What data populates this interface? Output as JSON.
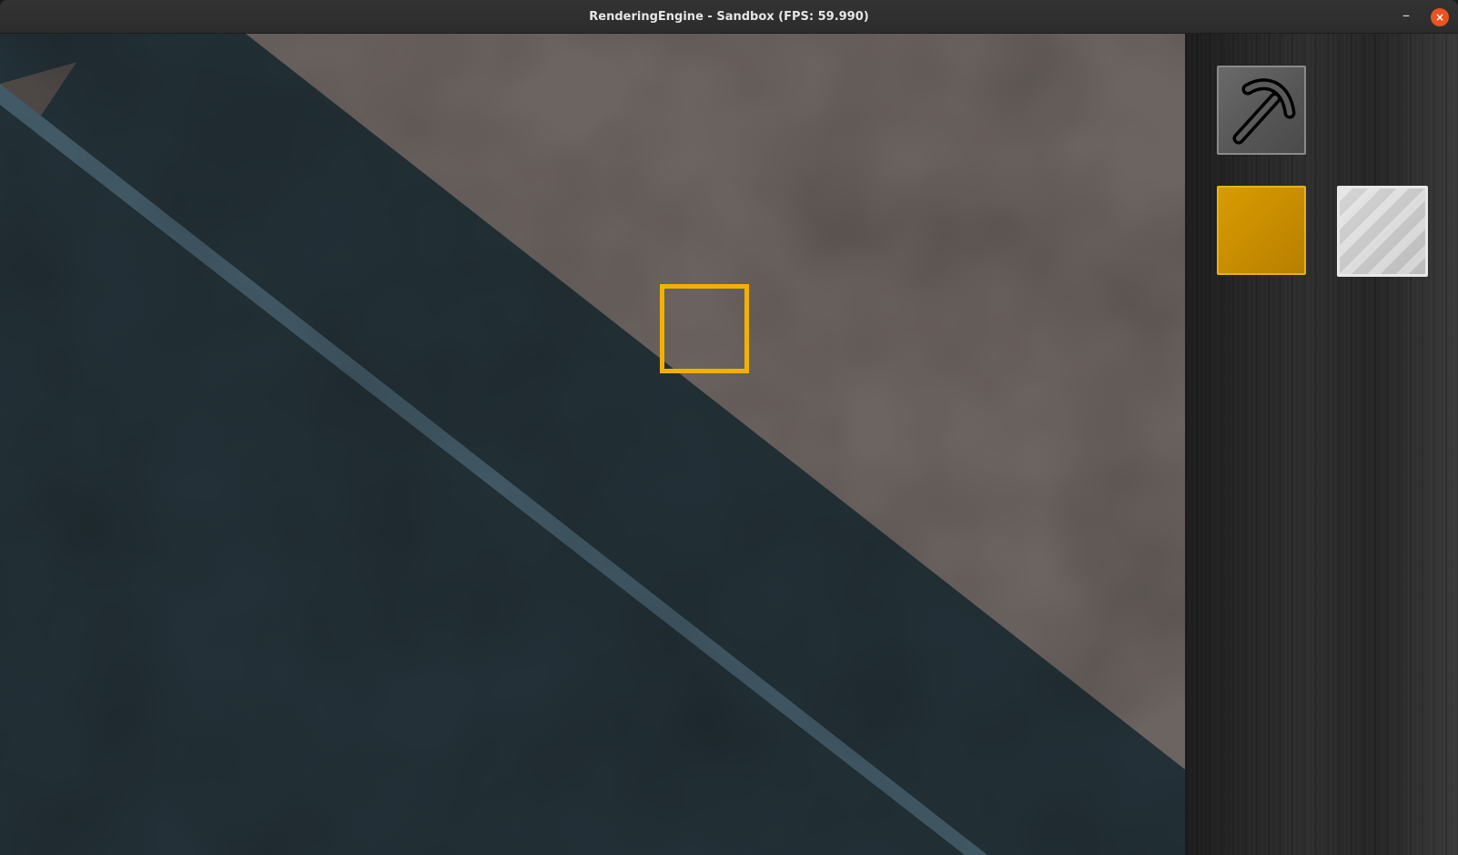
{
  "window": {
    "title": "RenderingEngine - Sandbox (FPS: 59.990)",
    "minimize_glyph": "–",
    "close_glyph": "×"
  },
  "colors": {
    "ground": "#6b625e",
    "dark_band": "#1b2a31",
    "blue_stripe": "#3e5866",
    "yellow_stripe": "#c8891b",
    "selection": "#f2b100",
    "gold_block": "#d79c00",
    "metal_block": "#cfcfcf",
    "sidebar": "#2a2a2a",
    "close_button": "#e95420"
  },
  "toolbar": {
    "slots": [
      {
        "name": "pickaxe",
        "icon": "pickaxe-icon"
      },
      {
        "name": "gold-block",
        "icon": "gold-block-icon"
      },
      {
        "name": "metal-block",
        "icon": "metal-block-icon"
      }
    ]
  }
}
